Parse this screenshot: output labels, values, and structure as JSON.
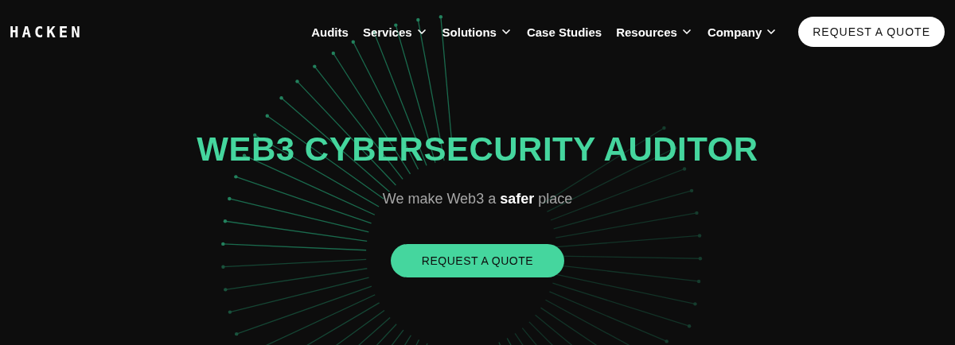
{
  "header": {
    "logo": "HACKEN",
    "nav": [
      {
        "label": "Audits",
        "kind": "link"
      },
      {
        "label": "Services",
        "kind": "dropdown"
      },
      {
        "label": "Solutions",
        "kind": "dropdown"
      },
      {
        "label": "Case Studies",
        "kind": "link"
      },
      {
        "label": "Resources",
        "kind": "dropdown"
      },
      {
        "label": "Company",
        "kind": "dropdown"
      }
    ],
    "cta": "REQUEST A QUOTE"
  },
  "hero": {
    "title": "WEB3 CYBERSECURITY AUDITOR",
    "subtitle": "We make Web3 a **safer** place",
    "button": "REQUEST A QUOTE"
  }
}
